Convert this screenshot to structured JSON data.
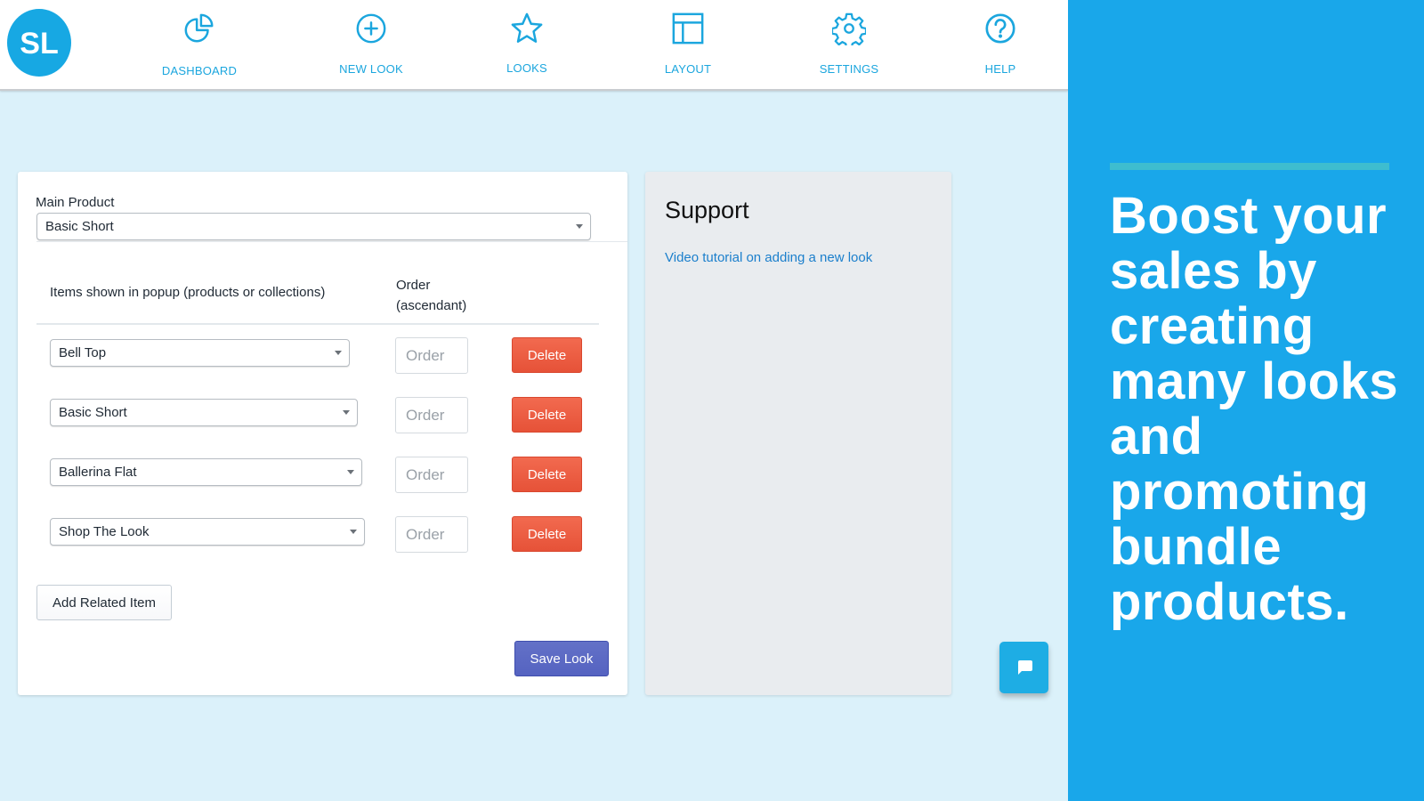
{
  "app": {
    "logo_text": "SL",
    "accent_color": "#1ba6de"
  },
  "nav": {
    "items": [
      {
        "label": "DASHBOARD",
        "icon": "pie-chart-icon"
      },
      {
        "label": "NEW LOOK",
        "icon": "plus-circle-icon"
      },
      {
        "label": "LOOKS",
        "icon": "star-icon"
      },
      {
        "label": "LAYOUT",
        "icon": "layout-icon"
      },
      {
        "label": "SETTINGS",
        "icon": "gear-icon"
      },
      {
        "label": "HELP",
        "icon": "help-circle-icon"
      }
    ]
  },
  "form": {
    "main_product_label": "Main Product",
    "main_product_value": "Basic Short",
    "column_items_header": "Items shown in popup (products or collections)",
    "column_order_header_line1": "Order",
    "column_order_header_line2": "(ascendant)",
    "order_placeholder": "Order",
    "delete_label": "Delete",
    "rows": [
      {
        "item": "Bell Top",
        "order": ""
      },
      {
        "item": "Basic Short",
        "order": ""
      },
      {
        "item": "Ballerina Flat",
        "order": ""
      },
      {
        "item": "Shop The Look",
        "order": ""
      }
    ],
    "add_related_label": "Add Related Item",
    "save_label": "Save Look"
  },
  "support": {
    "title": "Support",
    "link_text": "Video tutorial on adding a new look"
  },
  "chat": {
    "icon": "chat-bubble-icon"
  },
  "promo": {
    "headline": "Boost your sales by creating many looks and promoting bundle products.",
    "background_color": "#19a7ea",
    "bar_color": "#3ebdcf"
  }
}
